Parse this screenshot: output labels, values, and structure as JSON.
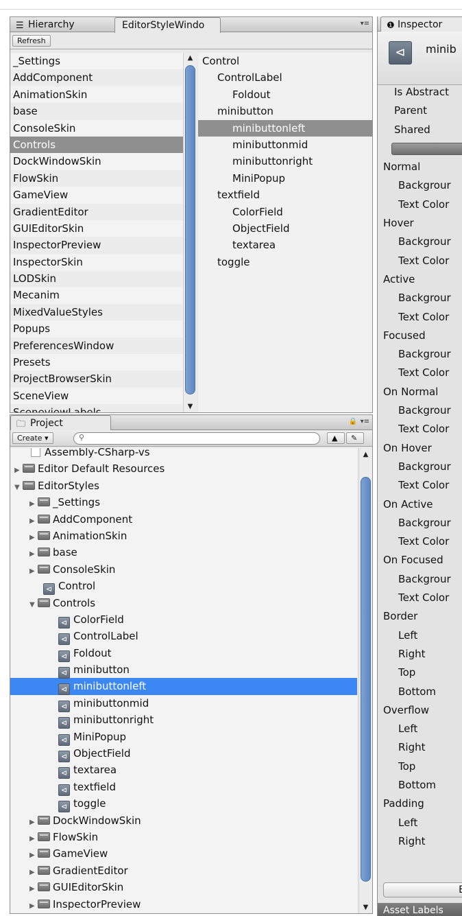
{
  "hierarchy": {
    "tab_hierarchy": "Hierarchy",
    "tab_editor": "EditorStyleWindo",
    "refresh": "Refresh",
    "styles": [
      "_Settings",
      "AddComponent",
      "AnimationSkin",
      "base",
      "ConsoleSkin",
      "Controls",
      "DockWindowSkin",
      "FlowSkin",
      "GameView",
      "GradientEditor",
      "GUIEditorSkin",
      "InspectorPreview",
      "InspectorSkin",
      "LODSkin",
      "Mecanim",
      "MixedValueStyles",
      "Popups",
      "PreferencesWindow",
      "Presets",
      "ProjectBrowserSkin",
      "SceneView",
      "SceneviewLabels"
    ],
    "controls_tree": [
      {
        "label": "Control",
        "indent": 0
      },
      {
        "label": "ControlLabel",
        "indent": 1
      },
      {
        "label": "Foldout",
        "indent": 2
      },
      {
        "label": "minibutton",
        "indent": 1
      },
      {
        "label": "minibuttonleft",
        "indent": 2
      },
      {
        "label": "minibuttonmid",
        "indent": 2
      },
      {
        "label": "minibuttonright",
        "indent": 2
      },
      {
        "label": "MiniPopup",
        "indent": 2
      },
      {
        "label": "textfield",
        "indent": 1
      },
      {
        "label": "ColorField",
        "indent": 2
      },
      {
        "label": "ObjectField",
        "indent": 2
      },
      {
        "label": "textarea",
        "indent": 2
      },
      {
        "label": "toggle",
        "indent": 1
      }
    ]
  },
  "project": {
    "tab": "Project",
    "create": "Create",
    "items": [
      {
        "label": "Assembly-CSharp-vs",
        "kind": "file",
        "depth": 1
      },
      {
        "label": "Editor Default Resources",
        "kind": "folder",
        "depth": 0,
        "open": false
      },
      {
        "label": "EditorStyles",
        "kind": "folder",
        "depth": 0,
        "open": true
      },
      {
        "label": "_Settings",
        "kind": "folder",
        "depth": 1,
        "open": false
      },
      {
        "label": "AddComponent",
        "kind": "folder",
        "depth": 1,
        "open": false
      },
      {
        "label": "AnimationSkin",
        "kind": "folder",
        "depth": 1,
        "open": false
      },
      {
        "label": "base",
        "kind": "folder",
        "depth": 1,
        "open": false
      },
      {
        "label": "ConsoleSkin",
        "kind": "folder",
        "depth": 1,
        "open": false
      },
      {
        "label": "Control",
        "kind": "asset",
        "depth": 1
      },
      {
        "label": "Controls",
        "kind": "folder",
        "depth": 1,
        "open": true
      },
      {
        "label": "ColorField",
        "kind": "asset",
        "depth": 2
      },
      {
        "label": "ControlLabel",
        "kind": "asset",
        "depth": 2
      },
      {
        "label": "Foldout",
        "kind": "asset",
        "depth": 2
      },
      {
        "label": "minibutton",
        "kind": "asset",
        "depth": 2
      },
      {
        "label": "minibuttonleft",
        "kind": "asset",
        "depth": 2,
        "selected": true
      },
      {
        "label": "minibuttonmid",
        "kind": "asset",
        "depth": 2
      },
      {
        "label": "minibuttonright",
        "kind": "asset",
        "depth": 2
      },
      {
        "label": "MiniPopup",
        "kind": "asset",
        "depth": 2
      },
      {
        "label": "ObjectField",
        "kind": "asset",
        "depth": 2
      },
      {
        "label": "textarea",
        "kind": "asset",
        "depth": 2
      },
      {
        "label": "textfield",
        "kind": "asset",
        "depth": 2
      },
      {
        "label": "toggle",
        "kind": "asset",
        "depth": 2
      },
      {
        "label": "DockWindowSkin",
        "kind": "folder",
        "depth": 1,
        "open": false
      },
      {
        "label": "FlowSkin",
        "kind": "folder",
        "depth": 1,
        "open": false
      },
      {
        "label": "GameView",
        "kind": "folder",
        "depth": 1,
        "open": false
      },
      {
        "label": "GradientEditor",
        "kind": "folder",
        "depth": 1,
        "open": false
      },
      {
        "label": "GUIEditorSkin",
        "kind": "folder",
        "depth": 1,
        "open": false
      },
      {
        "label": "InspectorPreview",
        "kind": "folder",
        "depth": 1,
        "open": false
      }
    ]
  },
  "inspector": {
    "tab": "Inspector",
    "object_name": "minib",
    "rows": [
      {
        "label": "Is Abstract",
        "indent": 1
      },
      {
        "label": "Parent",
        "indent": 1
      },
      {
        "label": "Shared",
        "indent": 1
      },
      {
        "label": "",
        "indent": 0,
        "bar": true
      },
      {
        "label": "Normal",
        "indent": 0
      },
      {
        "label": "Backgrour",
        "indent": 1
      },
      {
        "label": "Text Color",
        "indent": 1
      },
      {
        "label": "Hover",
        "indent": 0
      },
      {
        "label": "Backgrour",
        "indent": 1
      },
      {
        "label": "Text Color",
        "indent": 1
      },
      {
        "label": "Active",
        "indent": 0
      },
      {
        "label": "Backgrour",
        "indent": 1
      },
      {
        "label": "Text Color",
        "indent": 1
      },
      {
        "label": "Focused",
        "indent": 0
      },
      {
        "label": "Backgrour",
        "indent": 1
      },
      {
        "label": "Text Color",
        "indent": 1
      },
      {
        "label": "On Normal",
        "indent": 0
      },
      {
        "label": "Backgrour",
        "indent": 1
      },
      {
        "label": "Text Color",
        "indent": 1
      },
      {
        "label": "On Hover",
        "indent": 0
      },
      {
        "label": "Backgrour",
        "indent": 1
      },
      {
        "label": "Text Color",
        "indent": 1
      },
      {
        "label": "On Active",
        "indent": 0
      },
      {
        "label": "Backgrour",
        "indent": 1
      },
      {
        "label": "Text Color",
        "indent": 1
      },
      {
        "label": "On Focused",
        "indent": 0
      },
      {
        "label": "Backgrour",
        "indent": 1
      },
      {
        "label": "Text Color",
        "indent": 1
      },
      {
        "label": "Border",
        "indent": 0
      },
      {
        "label": "Left",
        "indent": 1
      },
      {
        "label": "Right",
        "indent": 1
      },
      {
        "label": "Top",
        "indent": 1
      },
      {
        "label": "Bottom",
        "indent": 1
      },
      {
        "label": "Overflow",
        "indent": 0
      },
      {
        "label": "Left",
        "indent": 1
      },
      {
        "label": "Right",
        "indent": 1
      },
      {
        "label": "Top",
        "indent": 1
      },
      {
        "label": "Bottom",
        "indent": 1
      },
      {
        "label": "Padding",
        "indent": 0
      },
      {
        "label": "Left",
        "indent": 1
      },
      {
        "label": "Right",
        "indent": 1
      }
    ],
    "button_label": "E",
    "asset_labels": "Asset Labels"
  }
}
